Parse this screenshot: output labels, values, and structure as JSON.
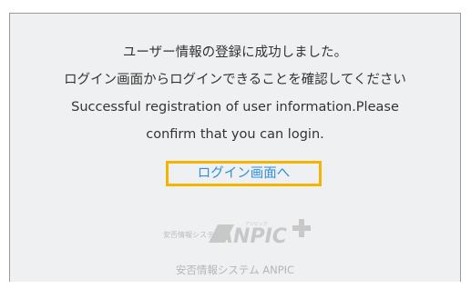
{
  "message": {
    "line1": "ユーザー情報の登録に成功しました。",
    "line2": "ログイン画面からログインできることを確認してください",
    "line3": "Successful registration of user information.Please",
    "line4": "confirm that you can login."
  },
  "link": {
    "label": "ログイン画面へ",
    "color": "#2b8fde",
    "focus_color": "#f5b400"
  },
  "logo": {
    "small_text": "安否情報システム",
    "brand": "ANPIC",
    "kana": "アンピック",
    "color": "#c8c8c8"
  },
  "footer": {
    "text": "安否情報システム ANPIC"
  }
}
